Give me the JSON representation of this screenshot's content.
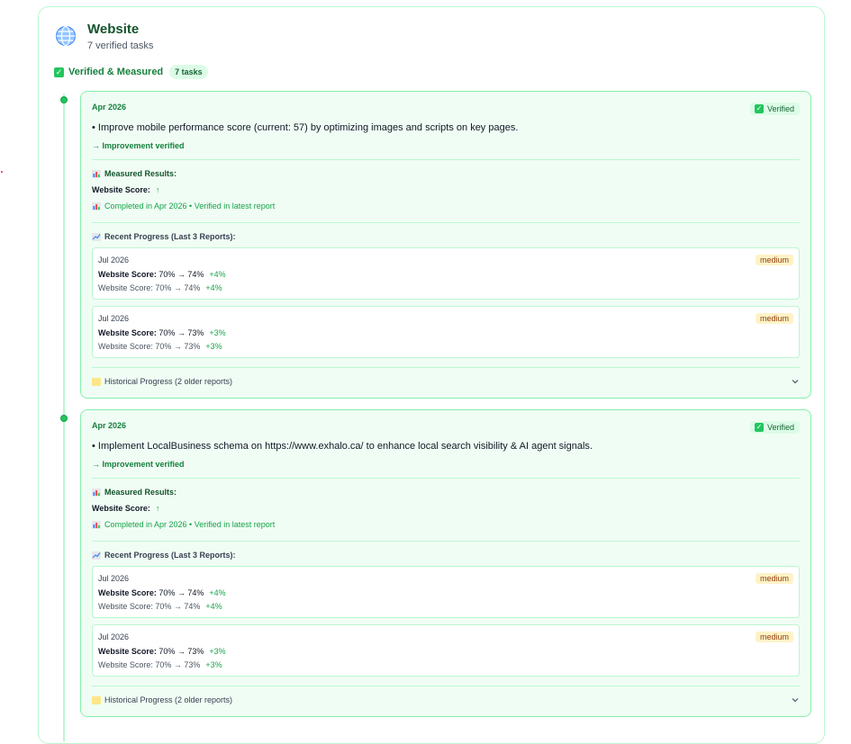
{
  "site": {
    "title": "Website",
    "subtitle": "7 verified tasks",
    "icon": "globe-icon"
  },
  "section": {
    "title": "Verified & Measured",
    "count": "7 tasks",
    "icon": "check-square-icon"
  },
  "cards": [
    {
      "date": "Apr 2026",
      "badge": "Verified",
      "task": "• Improve mobile performance score (current: 57) by optimizing images and scripts on key pages.",
      "improvement": "→ Improvement verified",
      "measured_label": "Measured Results:",
      "score_label": "Website Score:",
      "score_arrow": "↑",
      "completed": "Completed in Apr 2026 • Verified in latest report",
      "recent_label": "Recent Progress (Last 3 Reports):",
      "reports": [
        {
          "date": "Jul 2026",
          "level": "medium",
          "label": "Website Score:",
          "change": "70% → 74%",
          "delta": "+4%",
          "line2": "Website Score: 70% → 74%",
          "delta2": "+4%"
        },
        {
          "date": "Jul 2026",
          "level": "medium",
          "label": "Website Score:",
          "change": "70% → 73%",
          "delta": "+3%",
          "line2": "Website Score: 70% → 73%",
          "delta2": "+3%"
        }
      ],
      "history": "Historical Progress (2 older reports)"
    },
    {
      "date": "Apr 2026",
      "badge": "Verified",
      "task": "• Implement LocalBusiness schema on https://www.exhalo.ca/ to enhance local search visibility & AI agent signals.",
      "improvement": "→ Improvement verified",
      "measured_label": "Measured Results:",
      "score_label": "Website Score:",
      "score_arrow": "↑",
      "completed": "Completed in Apr 2026 • Verified in latest report",
      "recent_label": "Recent Progress (Last 3 Reports):",
      "reports": [
        {
          "date": "Jul 2026",
          "level": "medium",
          "label": "Website Score:",
          "change": "70% → 74%",
          "delta": "+4%",
          "line2": "Website Score: 70% → 74%",
          "delta2": "+4%"
        },
        {
          "date": "Jul 2026",
          "level": "medium",
          "label": "Website Score:",
          "change": "70% → 73%",
          "delta": "+3%",
          "line2": "Website Score: 70% → 73%",
          "delta2": "+3%"
        }
      ],
      "history": "Historical Progress (2 older reports)"
    }
  ],
  "colors": {
    "accent": "#16a34a",
    "card_bg": "#f0fdf4",
    "border": "#86efac",
    "medium_badge": "#fef3c7"
  }
}
